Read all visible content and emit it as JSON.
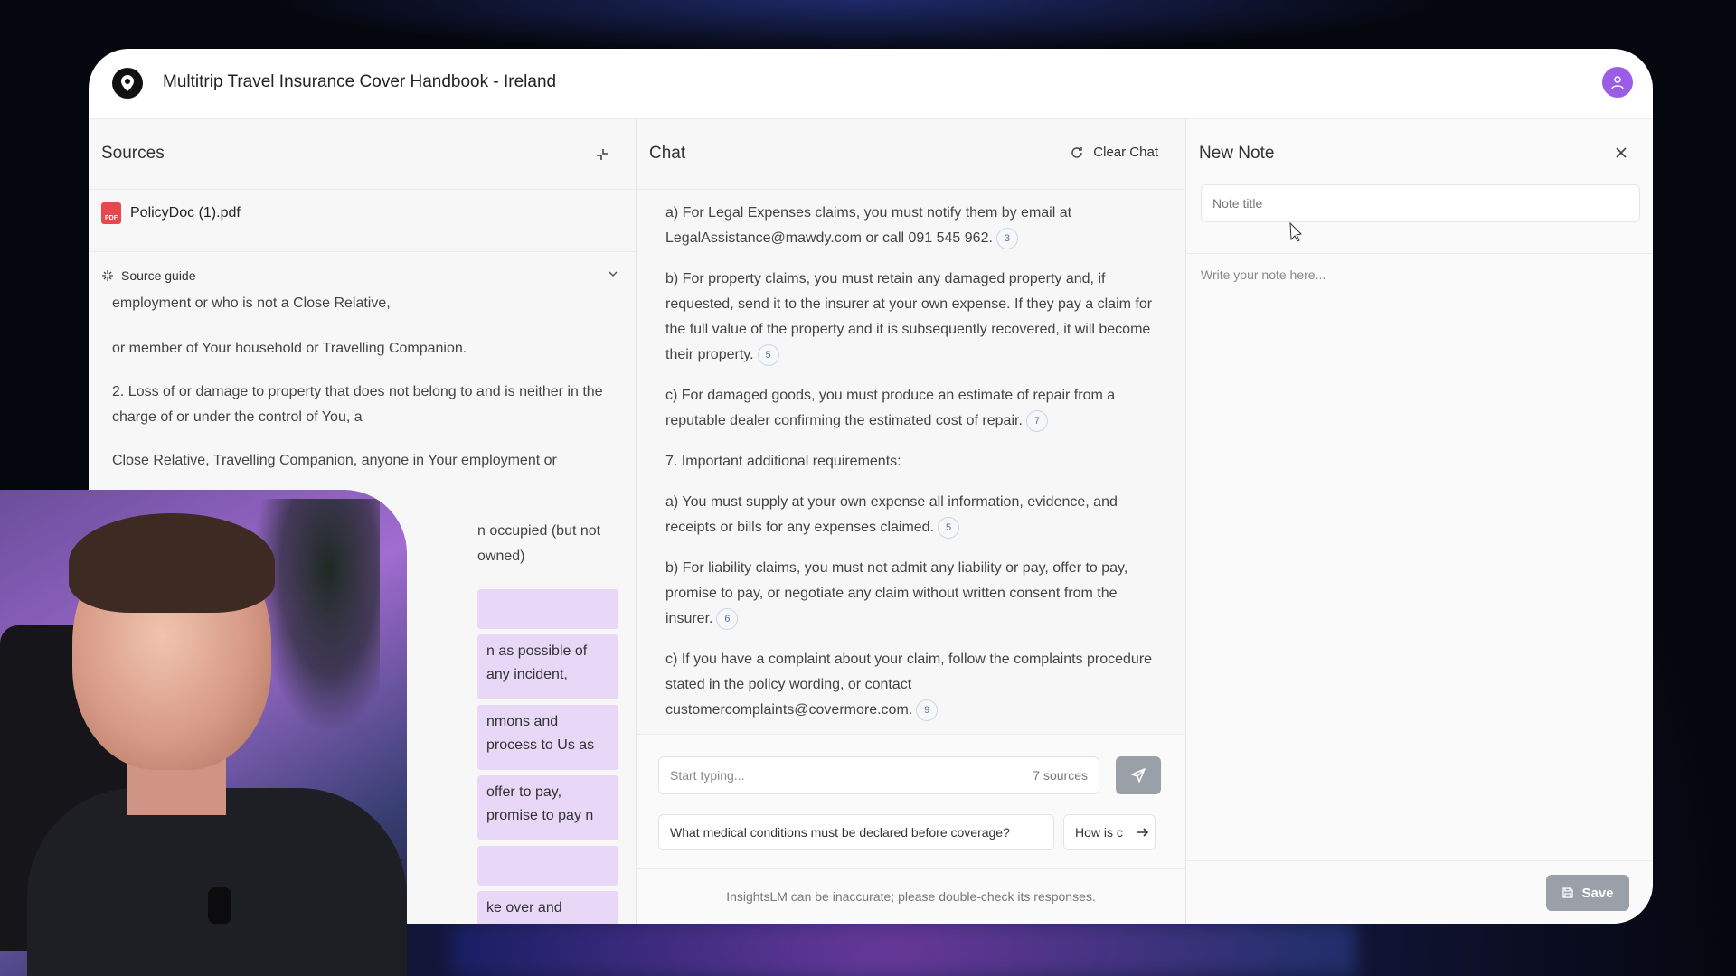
{
  "app": {
    "title": "Multitrip Travel Insurance Cover Handbook - Ireland"
  },
  "sources": {
    "title": "Sources",
    "file_name": "PolicyDoc (1).pdf",
    "file_type": "PDF",
    "guide_label": "Source guide",
    "text": [
      "employment or who is not a Close Relative,",
      "or member of Your household or Travelling Companion.",
      "2. Loss of or damage to property that does not belong to and is neither in the charge of or under the control of You, a",
      "Close Relative, Travelling Companion, anyone in Your employment or",
      "n occupied (but not owned)"
    ],
    "highlights": [
      "",
      "n as possible of any incident,",
      "nmons and process to Us as",
      "offer to pay, promise to pay n",
      "",
      "ke over and conduct in Your"
    ]
  },
  "chat": {
    "title": "Chat",
    "clear_label": "Clear Chat",
    "messages": [
      {
        "text": "a) For Legal Expenses claims, you must notify them by email at LegalAssistance@mawdy.com or call 091 545 962.",
        "cite": "3"
      },
      {
        "text": "b) For property claims, you must retain any damaged property and, if requested, send it to the insurer at your own expense. If they pay a claim for the full value of the property and it is subsequently recovered, it will become their property.",
        "cite": "5"
      },
      {
        "text": "c) For damaged goods, you must produce an estimate of repair from a reputable dealer confirming the estimated cost of repair.",
        "cite": "7"
      },
      {
        "text": "7. Important additional requirements:",
        "cite": ""
      },
      {
        "text": "a) You must supply at your own expense all information, evidence, and receipts or bills for any expenses claimed.",
        "cite": "5"
      },
      {
        "text": "b) For liability claims, you must not admit any liability or pay, offer to pay, promise to pay, or negotiate any claim without written consent from the insurer.",
        "cite": "6"
      },
      {
        "text": "c) If you have a complaint about your claim, follow the complaints procedure stated in the policy wording, or contact customercomplaints@covermore.com.",
        "cite": "9"
      }
    ],
    "input_placeholder": "Start typing...",
    "sources_count": "7 sources",
    "suggestions": [
      "What medical conditions must be declared before coverage?",
      "How is c"
    ],
    "disclaimer": "InsightsLM can be inaccurate; please double-check its responses."
  },
  "note": {
    "title": "New Note",
    "title_placeholder": "Note title",
    "body_placeholder": "Write your note here...",
    "save_label": "Save"
  },
  "colors": {
    "accent_purple": "#9b5de5",
    "highlight": "#e8d7f7",
    "disabled_button": "#9aa0a8",
    "pdf_red": "#e5484d"
  }
}
